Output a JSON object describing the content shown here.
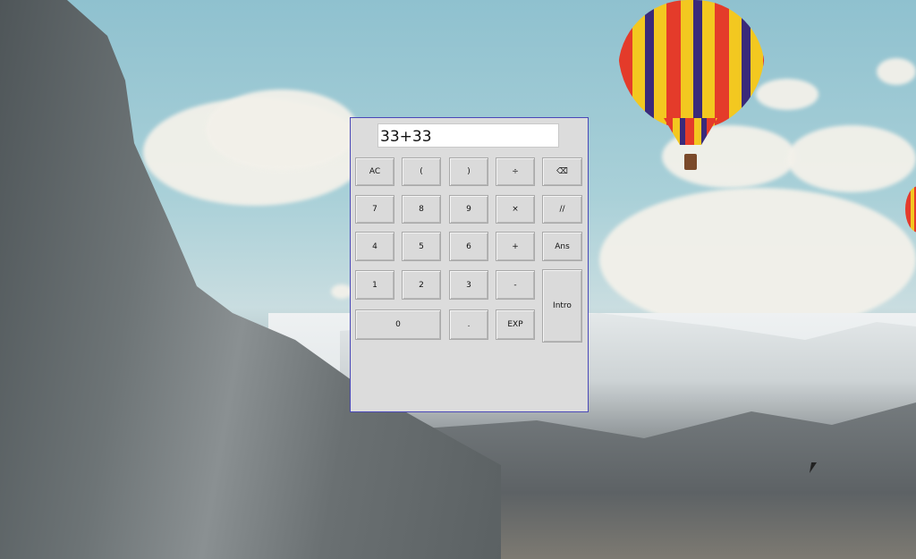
{
  "calculator": {
    "display_value": "33+33",
    "buttons": {
      "ac": "AC",
      "open_paren": "(",
      "close_paren": ")",
      "divide": "÷",
      "backspace": "⌫",
      "seven": "7",
      "eight": "8",
      "nine": "9",
      "multiply": "×",
      "floor_divide": "//",
      "four": "4",
      "five": "5",
      "six": "6",
      "plus": "+",
      "ans": "Ans",
      "one": "1",
      "two": "2",
      "three": "3",
      "minus": "-",
      "intro": "Intro",
      "zero": "0",
      "decimal": ".",
      "exp": "EXP"
    }
  },
  "colors": {
    "window_border": "#4a48b8",
    "window_background": "#dcdcdc",
    "button_background": "#dadada"
  }
}
